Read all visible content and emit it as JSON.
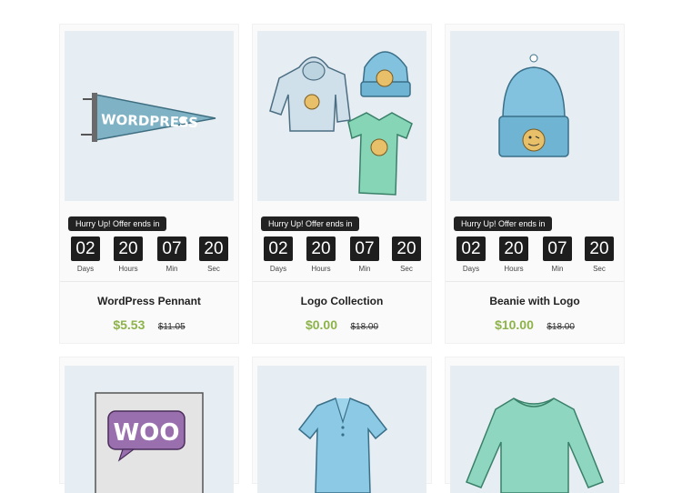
{
  "countdown_labels": {
    "days": "Days",
    "hours": "Hours",
    "min": "Min",
    "sec": "Sec"
  },
  "products": [
    {
      "name": "WordPress Pennant",
      "badge": "Hurry Up! Offer ends in",
      "days": "02",
      "hours": "20",
      "min": "07",
      "sec": "20",
      "price": "$5.53",
      "old_price": "$11.05",
      "image": "pennant-illustration",
      "pennant_text": "WORDPRESS"
    },
    {
      "name": "Logo Collection",
      "badge": "Hurry Up! Offer ends in",
      "days": "02",
      "hours": "20",
      "min": "07",
      "sec": "20",
      "price": "$0.00",
      "old_price": "$18.00",
      "image": "logo-collection-illustration"
    },
    {
      "name": "Beanie with Logo",
      "badge": "Hurry Up! Offer ends in",
      "days": "02",
      "hours": "20",
      "min": "07",
      "sec": "20",
      "price": "$10.00",
      "old_price": "$18.00",
      "image": "beanie-illustration"
    },
    {
      "image": "woo-album-illustration",
      "woo_text": "WOO"
    },
    {
      "image": "polo-illustration"
    },
    {
      "image": "long-sleeve-tee-illustration"
    }
  ],
  "colors": {
    "price": "#8db34a",
    "badge_bg": "#222222",
    "image_bg": "#e6edf3"
  }
}
